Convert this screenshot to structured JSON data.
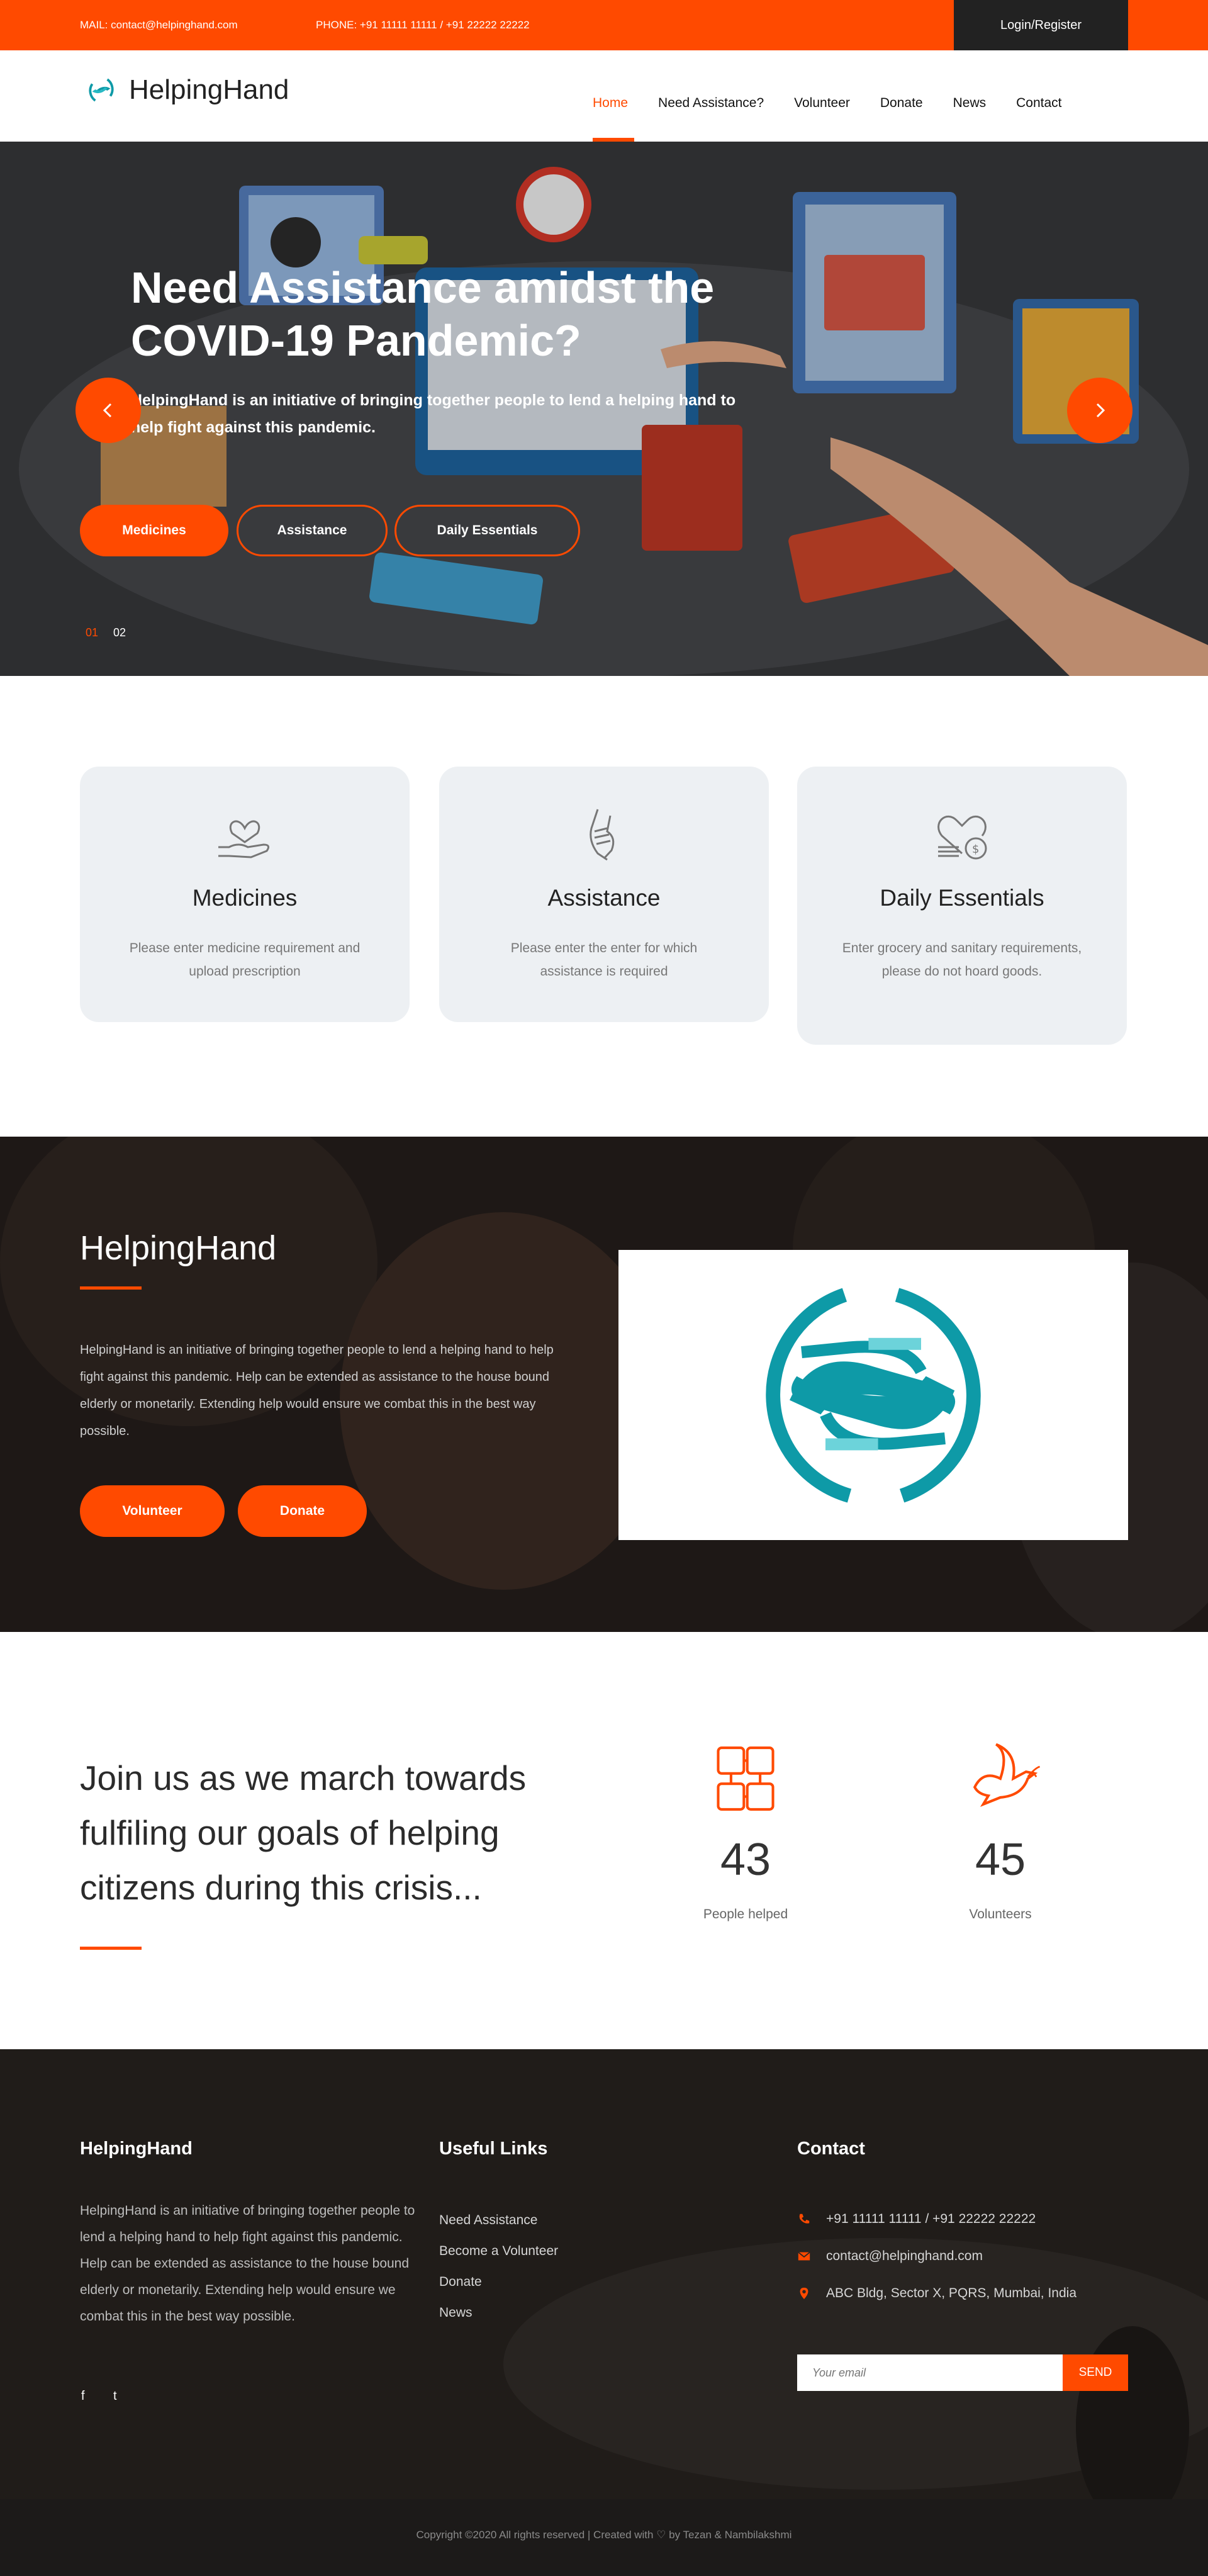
{
  "topbar": {
    "mail": "MAIL: contact@helpinghand.com",
    "phone": "PHONE: +91 11111 11111 / +91 22222 22222",
    "login": "Login/Register"
  },
  "nav": {
    "brand": "HelpingHand",
    "links": [
      "Home",
      "Need Assistance?",
      "Volunteer",
      "Donate",
      "News",
      "Contact"
    ],
    "active": "Home"
  },
  "hero": {
    "title": "Need Assistance amidst the COVID-19 Pandemic?",
    "subtitle": "HelpingHand is an initiative of bringing together people to lend a helping hand to help fight against this pandemic.",
    "buttons": [
      "Medicines",
      "Assistance",
      "Daily Essentials"
    ],
    "slides": [
      "01",
      "02"
    ],
    "prev_icon": "chevron-left-icon",
    "next_icon": "chevron-right-icon"
  },
  "services": [
    {
      "icon": "heart-in-hand-icon",
      "title": "Medicines",
      "desc": "Please enter medicine requirement and upload prescription"
    },
    {
      "icon": "helping-hands-icon",
      "title": "Assistance",
      "desc": "Please enter the enter for which assistance is required"
    },
    {
      "icon": "heart-coins-icon",
      "title": "Daily Essentials",
      "desc": "Enter grocery and sanitary requirements, please do not hoard goods."
    }
  ],
  "about": {
    "title": "HelpingHand",
    "text": "HelpingHand is an initiative of bringing together people to lend a helping hand to help fight against this pandemic. Help can be extended as assistance to the house bound elderly or monetarily. Extending help would ensure we combat this in the best way possible.",
    "buttons": [
      "Volunteer",
      "Donate"
    ]
  },
  "join": {
    "title": "Join us as we march towards fulfiling our goals of helping citizens during this crisis...",
    "stats": [
      {
        "icon": "joined-hands-icon",
        "value": "43",
        "label": "People helped"
      },
      {
        "icon": "dove-icon",
        "value": "45",
        "label": "Volunteers"
      }
    ]
  },
  "footer": {
    "about_head": "HelpingHand",
    "about_text": "HelpingHand is an initiative of bringing together people to lend a helping hand to help fight against this pandemic. Help can be extended as assistance to the house bound elderly or monetarily. Extending help would ensure we combat this in the best way possible.",
    "social": [
      "f",
      "t"
    ],
    "links_head": "Useful Links",
    "links": [
      "Need Assistance",
      "Become a Volunteer",
      "Donate",
      "News"
    ],
    "contact_head": "Contact",
    "contact": [
      {
        "icon": "phone-icon",
        "text": "+91 11111 11111 / +91 22222 22222"
      },
      {
        "icon": "mail-icon",
        "text": "contact@helpinghand.com"
      },
      {
        "icon": "location-pin-icon",
        "text": "ABC Bldg, Sector X, PQRS, Mumbai, India"
      }
    ],
    "email_placeholder": "Your email",
    "send": "SEND",
    "copyright": "Copyright ©2020 All rights reserved | Created with ♡ by Tezan & Nambilakshmi"
  },
  "colors": {
    "accent": "#ff4a00",
    "dark": "#222222",
    "card_bg": "#edf0f3",
    "logo_teal": "#0e9aa7"
  }
}
